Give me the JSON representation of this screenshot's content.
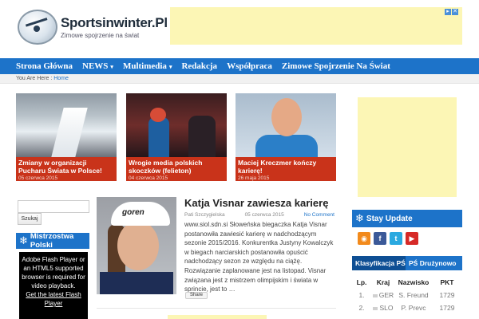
{
  "site": {
    "title": "Sportsinwinter.Pl",
    "tagline": "Zimowe spojrzenie na świat"
  },
  "nav": {
    "items": [
      {
        "label": "Strona Główna",
        "caret": false
      },
      {
        "label": "NEWS",
        "caret": true
      },
      {
        "label": "Multimedia",
        "caret": true
      },
      {
        "label": "Redakcja",
        "caret": false
      },
      {
        "label": "Współpraca",
        "caret": false
      },
      {
        "label": "Zimowe Spojrzenie Na Świat",
        "caret": false
      }
    ],
    "caret_symbol": "▾"
  },
  "breadcrumb": {
    "prefix": "You Are Here :",
    "current": "Home"
  },
  "featured": [
    {
      "title": "Zmiany w organizacji Pucharu Świata w Polsce!",
      "date": "05 czerwca 2015"
    },
    {
      "title": "Wrogie media polskich skoczków (felieton)",
      "date": "04 czerwca 2015"
    },
    {
      "title": "Maciej Kreczmer kończy karierę!",
      "date": "26 maja 2015"
    }
  ],
  "sidebar_left": {
    "search_button": "Szukaj",
    "widget_title": "Mistrzostwa Polski",
    "flash_text": "Adobe Flash Player or an HTML5 supported browser is required for video playback.",
    "flash_link": "Get the latest Flash Player"
  },
  "article": {
    "title": "Katja Visnar zawiesza karierę",
    "author": "Pati Szczygielska",
    "date": "05 czerwca 2015",
    "comments": "No Comment",
    "image_text": "goren",
    "body": "www.siol.sdn.si Słoweńska biegaczka Katja Visnar postanowiła zawiesić karierę w nadchodzącym sezonie 2015/2016.  Konkurentka Justyny Kowalczyk w biegach narciarskich postanowiła opuścić nadchodzący sezon ze względu na ciążę. Rozwiązanie zaplanowane jest na listopad. Visnar związana jest z mistrzem olimpijskim i świata w sprincie, jest to …",
    "share": "Share"
  },
  "sidebar_right": {
    "stay_title": "Stay Update",
    "social": [
      {
        "name": "rss-icon",
        "glyph": "◉"
      },
      {
        "name": "facebook-icon",
        "glyph": "f"
      },
      {
        "name": "twitter-icon",
        "glyph": "t"
      },
      {
        "name": "youtube-icon",
        "glyph": "▶"
      }
    ],
    "tabs": [
      "Klasyfikacja PŚ",
      "PŚ Drużynowo"
    ],
    "table": {
      "headers": [
        "Lp.",
        "Kraj",
        "Nazwisko",
        "PKT"
      ],
      "rows": [
        [
          "1.",
          "GER",
          "S. Freund",
          "1729"
        ],
        [
          "2.",
          "SLO",
          "P. Prevc",
          "1729"
        ]
      ]
    }
  },
  "colors": {
    "nav_blue": "#1d73c9",
    "caption_red": "#c9331a",
    "ad_yellow": "#fcf6b5"
  }
}
